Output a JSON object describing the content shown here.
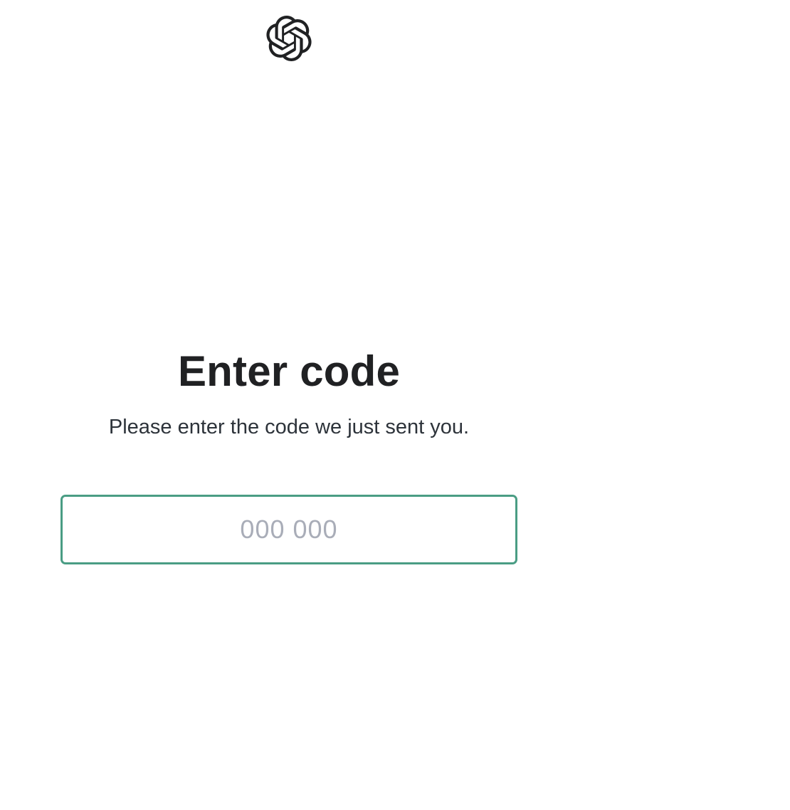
{
  "logo": {
    "icon": "openai-logo-icon"
  },
  "header": {
    "title": "Enter code",
    "subtitle": "Please enter the code we just sent you."
  },
  "code_field": {
    "value": "",
    "placeholder": "000 000"
  },
  "colors": {
    "accent_border": "#4a9d84",
    "title_text": "#202123",
    "body_text": "#2d333a",
    "placeholder_text": "#a9adb8"
  }
}
